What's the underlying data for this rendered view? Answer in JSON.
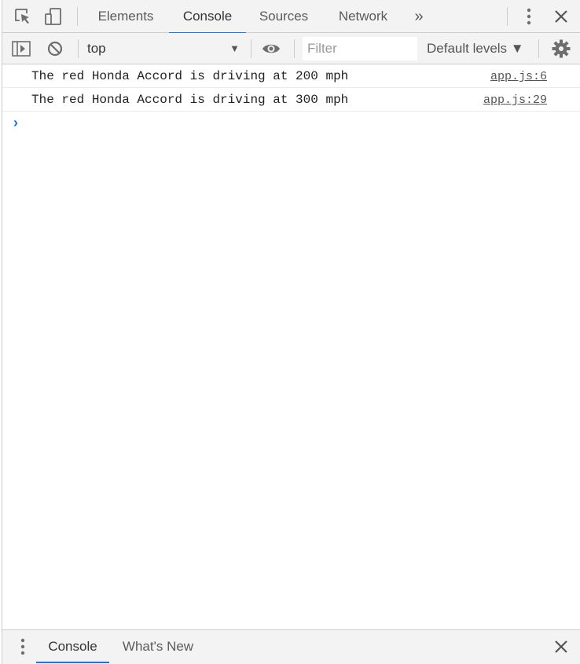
{
  "tabbar": {
    "tabs": [
      {
        "label": "Elements"
      },
      {
        "label": "Console"
      },
      {
        "label": "Sources"
      },
      {
        "label": "Network"
      }
    ],
    "more_label": "»"
  },
  "toolbar": {
    "context": "top",
    "filter_placeholder": "Filter",
    "levels_label": "Default levels ▼"
  },
  "messages": [
    {
      "text": "The red Honda Accord is driving at 200 mph",
      "source": "app.js:6"
    },
    {
      "text": "The red Honda Accord is driving at 300 mph",
      "source": "app.js:29"
    }
  ],
  "prompt": {
    "caret": "›"
  },
  "drawer": {
    "tabs": [
      {
        "label": "Console"
      },
      {
        "label": "What's New"
      }
    ]
  },
  "colors": {
    "accent": "#1a73e8",
    "toolbar_bg": "#f3f3f3",
    "border": "#cccccc"
  }
}
